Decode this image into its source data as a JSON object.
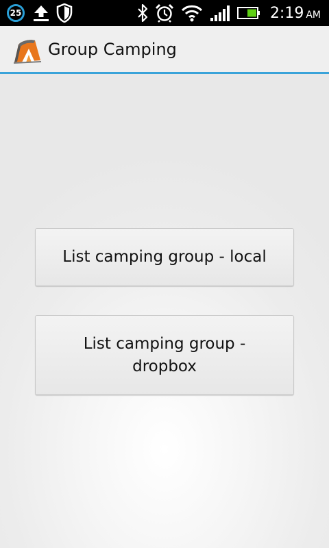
{
  "status_bar": {
    "notification_count": "25",
    "time": "2:19",
    "ampm": "AM",
    "icons_left": [
      "notification-count-badge",
      "upload-icon",
      "shield-icon"
    ],
    "icons_right": [
      "bluetooth-icon",
      "alarm-icon",
      "wifi-icon",
      "signal-icon",
      "battery-icon"
    ],
    "accent_color": "#2aa0d8",
    "battery_color": "#5fd014"
  },
  "action_bar": {
    "title": "Group Camping",
    "icon": "tent-logo-icon",
    "accent_color": "#3aa3d9"
  },
  "buttons": {
    "list_local_label": "List camping group - local",
    "list_dropbox_label": "List camping group - dropbox"
  }
}
